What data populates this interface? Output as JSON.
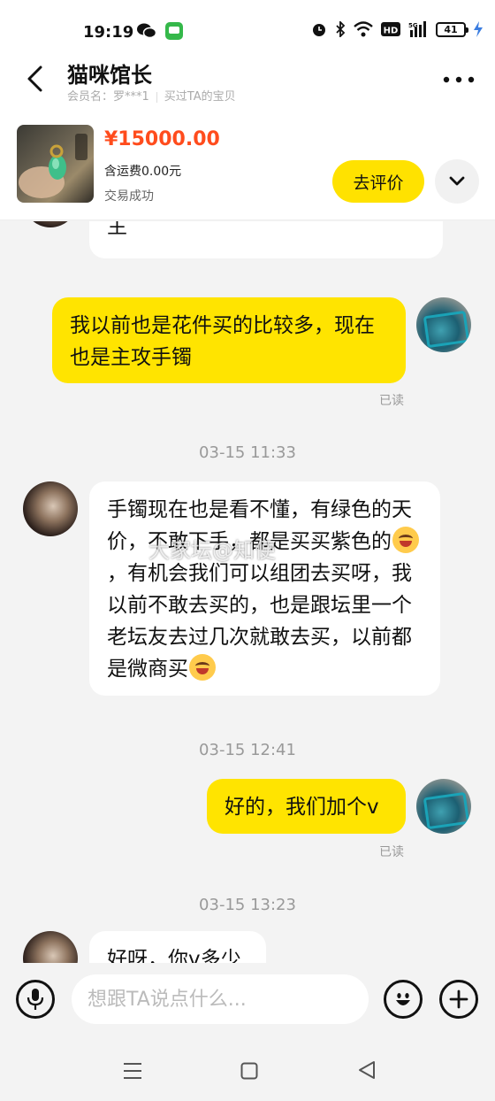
{
  "status_bar": {
    "time": "19:19",
    "battery": "41"
  },
  "header": {
    "title": "猫咪馆长",
    "member_label": "会员名：罗***1",
    "bought_label": "买过TA的宝贝"
  },
  "product": {
    "price": "¥15000.00",
    "shipping": "含运费0.00元",
    "status": "交易成功",
    "review_button": "去评价"
  },
  "messages": [
    {
      "side": "other",
      "text": "主"
    },
    {
      "side": "self",
      "text": "我以前也是花件买的比较多，现在也是主攻手镯",
      "read": "已读"
    },
    {
      "side": "time",
      "text": "03-15 11:33"
    },
    {
      "side": "other",
      "text_part1": "手镯现在也是看不懂，有绿色的天价，不敢下手，都是买买紫色的",
      "text_part2": "，有机会我们可以组团去买呀，我以前不敢去买的，也是跟坛里一个老坛友去过几次就敢去买，以前都是微商买"
    },
    {
      "side": "time",
      "text": "03-15 12:41"
    },
    {
      "side": "self",
      "text": "好的，我们加个v",
      "read": "已读"
    },
    {
      "side": "time",
      "text": "03-15 13:23"
    },
    {
      "side": "other",
      "text": "好呀，你v多少"
    }
  ],
  "watermark": "大家坛@知便",
  "input": {
    "placeholder": "想跟TA说点什么..."
  },
  "colors": {
    "accent_yellow": "#ffe400",
    "price_orange": "#ff4c1d"
  }
}
